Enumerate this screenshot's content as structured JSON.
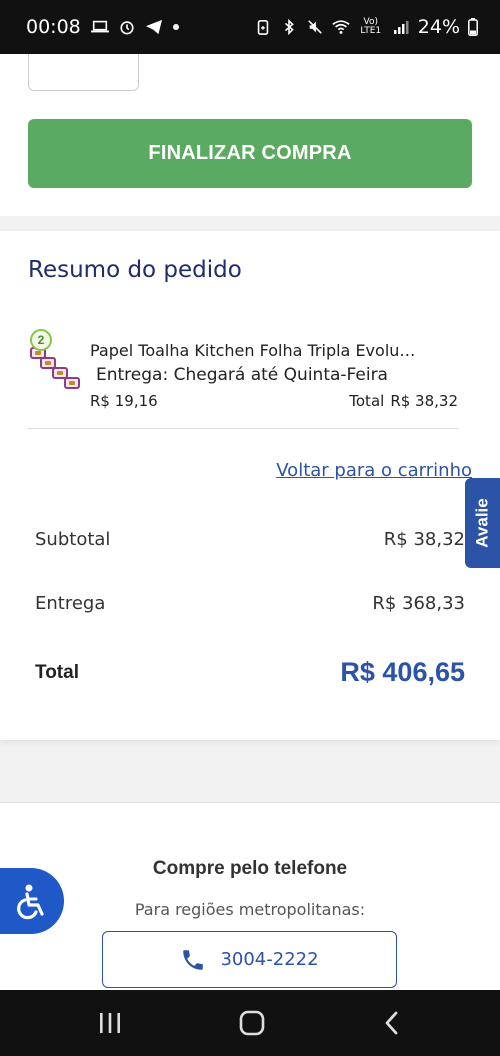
{
  "status_bar": {
    "time": "00:08",
    "battery_percent": "24%",
    "network_label": "Vo) LTE1",
    "left_icons": [
      "laptop-icon",
      "alarm-icon",
      "telegram-icon",
      "dot-icon"
    ],
    "right_icons": [
      "battery-saver-icon",
      "bluetooth-icon",
      "mute-icon",
      "wifi-icon",
      "volte-icon",
      "signal-icon",
      "battery-icon"
    ]
  },
  "checkout": {
    "finalize_label": "FINALIZAR COMPRA"
  },
  "summary": {
    "title": "Resumo do pedido",
    "item": {
      "quantity": "2",
      "name": "Papel Toalha Kitchen Folha Tripla Evoluti…",
      "delivery": "Entrega: Chegará até Quinta-Feira",
      "unit_price": "R$ 19,16",
      "total_label": "Total",
      "total_value": "R$ 38,32"
    },
    "back_link": "Voltar para o carrinho",
    "subtotal_label": "Subtotal",
    "subtotal_value": "R$ 38,32",
    "delivery_label": "Entrega",
    "delivery_value": "R$ 368,33",
    "total_label": "Total",
    "total_value": "R$ 406,65"
  },
  "side_tab": {
    "label": "Avalie"
  },
  "phone": {
    "title": "Compre pelo telefone",
    "subtitle": "Para regiões metropolitanas:",
    "number": "3004-2222"
  },
  "colors": {
    "accent_green": "#5aaa62",
    "brand_blue": "#2b53a6",
    "title_navy": "#1f2d6b"
  }
}
